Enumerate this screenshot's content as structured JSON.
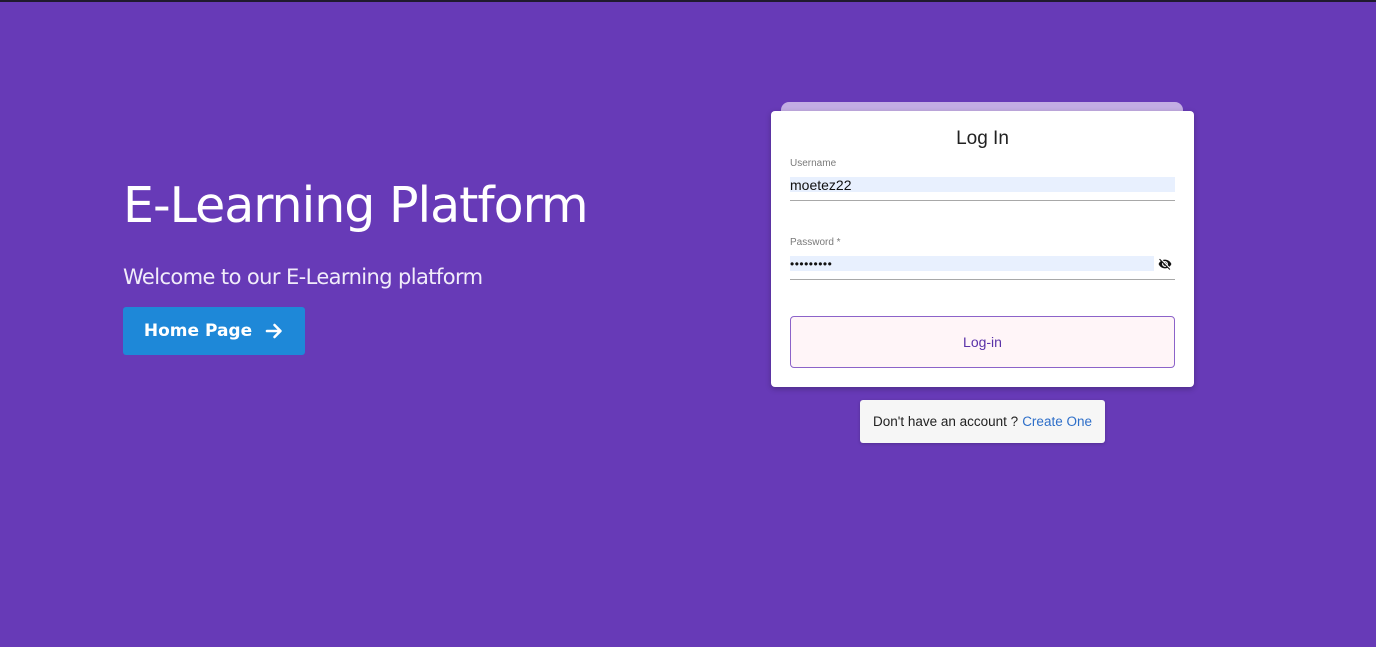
{
  "hero": {
    "title": "E-Learning Platform",
    "subtitle": "Welcome to our E-Learning platform",
    "home_button_label": "Home Page",
    "home_button_icon": "arrow-right-icon",
    "home_button_color": "#1e88d8"
  },
  "login_card": {
    "title": "Log In",
    "username": {
      "label": "Username",
      "value": "moetez22"
    },
    "password": {
      "label": "Password *",
      "value": "•••••••••",
      "toggle_icon": "eye-off-icon"
    },
    "submit_label": "Log-in"
  },
  "signup": {
    "prompt": "Don't have an account ?",
    "link_label": "Create One"
  },
  "colors": {
    "background": "#673ab7",
    "card_tab": "#c3ade3",
    "link": "#2e6fc9"
  }
}
